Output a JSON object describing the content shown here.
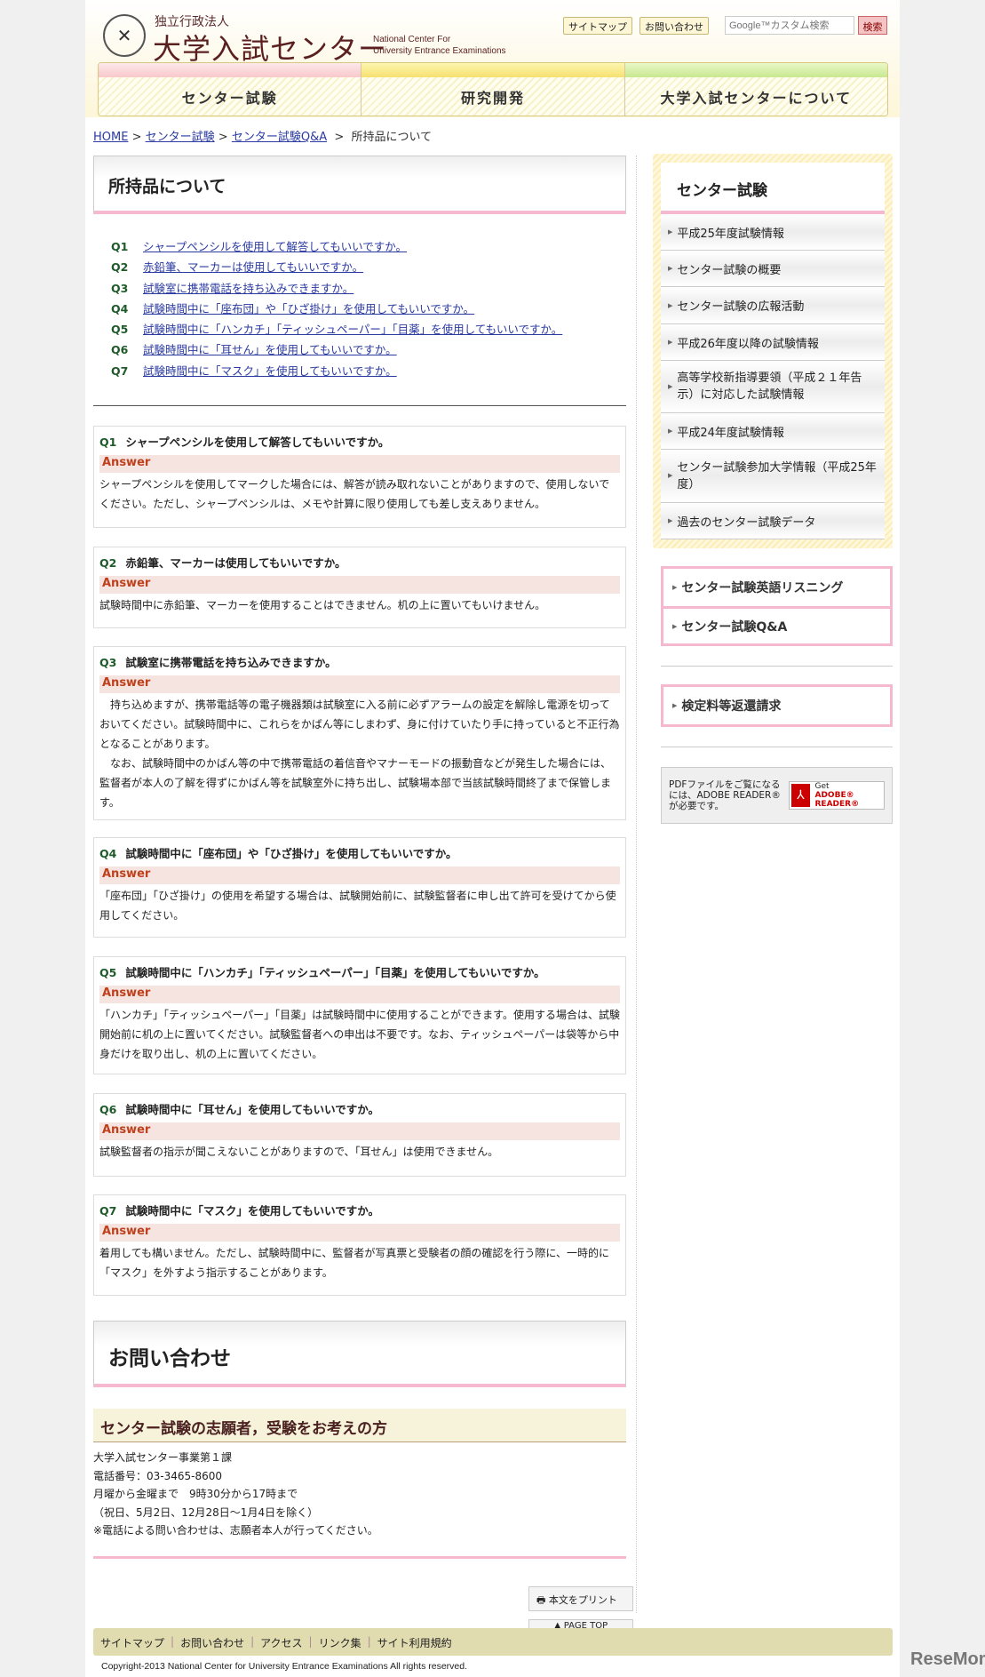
{
  "header": {
    "org_type": "独立行政法人",
    "org_name": "大学入試センター",
    "org_en_1": "National Center For",
    "org_en_2": "University Entrance Examinations",
    "sitemap": "サイトマップ",
    "contact": "お問い合わせ",
    "search_placeholder": "Google™カスタム検索",
    "search_button": "検索"
  },
  "nav": [
    {
      "label": "センター試験",
      "color": "#f8c8cc"
    },
    {
      "label": "研究開発",
      "color": "#f5e070"
    },
    {
      "label": "大学入試センターについて",
      "color": "#c8e890"
    }
  ],
  "breadcrumb": {
    "home": "HOME",
    "sep": ">",
    "b1": "センター試験",
    "b2": "センター試験Q&A",
    "current": "所持品について"
  },
  "main": {
    "title": "所持品について",
    "qa": [
      {
        "num": "Q1",
        "q": "シャープペンシルを使用して解答してもいいですか。",
        "a": "シャープペンシルを使用してマークした場合には、解答が読み取れないことがありますので、使用しないでください。ただし、シャープペンシルは、メモや計算に限り使用しても差し支えありません。"
      },
      {
        "num": "Q2",
        "q": "赤鉛筆、マーカーは使用してもいいですか。",
        "a": "試験時間中に赤鉛筆、マーカーを使用することはできません。机の上に置いてもいけません。"
      },
      {
        "num": "Q3",
        "q": "試験室に携帯電話を持ち込みできますか。",
        "a": "　持ち込めますが、携帯電話等の電子機器類は試験室に入る前に必ずアラームの設定を解除し電源を切っておいてください。試験時間中に、これらをかばん等にしまわず、身に付けていたり手に持っていると不正行為となることがあります。",
        "a2": "　なお、試験時間中のかばん等の中で携帯電話の着信音やマナーモードの振動音などが発生した場合には、監督者が本人の了解を得ずにかばん等を試験室外に持ち出し、試験場本部で当該試験時間終了まで保管します。"
      },
      {
        "num": "Q4",
        "q": "試験時間中に「座布団」や「ひざ掛け」を使用してもいいですか。",
        "a": "「座布団」「ひざ掛け」の使用を希望する場合は、試験開始前に、試験監督者に申し出て許可を受けてから使用してください。"
      },
      {
        "num": "Q5",
        "q": "試験時間中に「ハンカチ」「ティッシュペーパー」「目薬」を使用してもいいですか。",
        "a": "「ハンカチ」「ティッシュペーパー」「目薬」は試験時間中に使用することができます。使用する場合は、試験開始前に机の上に置いてください。試験監督者への申出は不要です。なお、ティッシュペーパーは袋等から中身だけを取り出し、机の上に置いてください。"
      },
      {
        "num": "Q6",
        "q": "試験時間中に「耳せん」を使用してもいいですか。",
        "a": "試験監督者の指示が聞こえないことがありますので、「耳せん」は使用できません。"
      },
      {
        "num": "Q7",
        "q": "試験時間中に「マスク」を使用してもいいですか。",
        "a": "着用しても構いません。ただし、試験時間中に、監督者が写真票と受験者の顔の確認を行う際に、一時的に「マスク」を外すよう指示することがあります。"
      }
    ],
    "answer_label": "Answer",
    "contact": {
      "title": "お問い合わせ",
      "subtitle": "センター試験の志願者，受験をお考えの方",
      "lines": [
        "大学入試センター事業第１課",
        "電話番号：03-3465-8600",
        "月曜から金曜まで　9時30分から17時まで",
        "（祝日、5月2日、12月28日～1月4日を除く）",
        "※電話による問い合わせは、志願者本人が行ってください。"
      ]
    },
    "print": "本文をプリント",
    "page_top": "PAGE TOP"
  },
  "sidebar": {
    "title": "センター試験",
    "items": [
      "平成25年度試験情報",
      "センター試験の概要",
      "センター試験の広報活動",
      "平成26年度以降の試験情報",
      "高等学校新指導要領（平成２１年告示）に対応した試験情報",
      "平成24年度試験情報",
      "センター試験参加大学情報（平成25年度）",
      "過去のセンター試験データ"
    ],
    "pink1": [
      "センター試験英語リスニング",
      "センター試験Q&A"
    ],
    "pink2": "検定料等返還請求",
    "pdf_text": "PDFファイルをご覧になるには、ADOBE READER®が必要です。",
    "adobe_get": "Get",
    "adobe_reader": "ADOBE® READER®"
  },
  "footer": {
    "links": [
      "サイトマップ",
      "お問い合わせ",
      "アクセス",
      "リンク集",
      "サイト利用規約"
    ],
    "copyright": "Copyright-2013 National Center for University Entrance Examinations All rights reserved."
  },
  "watermark": "ReseMom"
}
